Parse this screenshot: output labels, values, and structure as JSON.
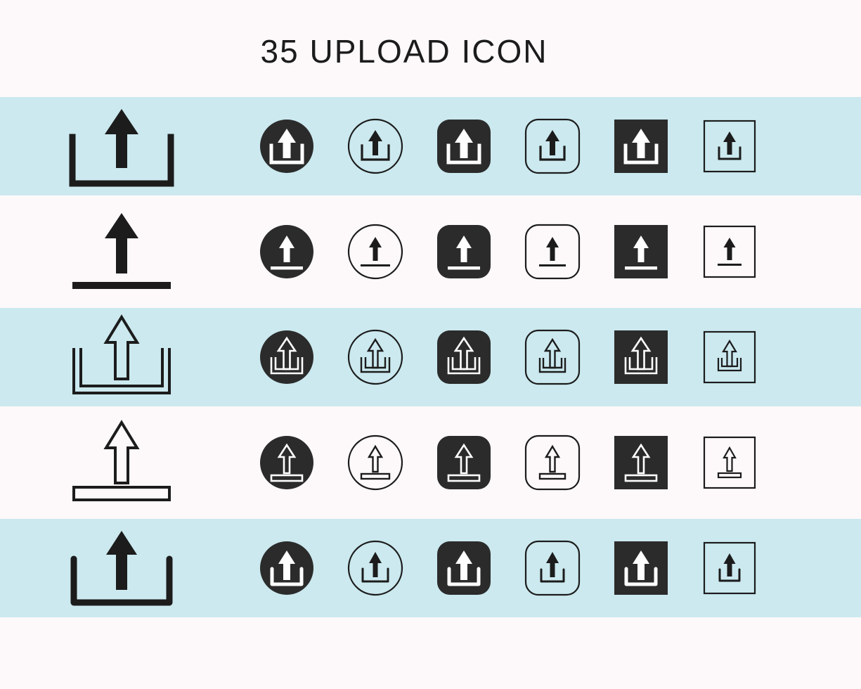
{
  "page": {
    "title": "35 UPLOAD ICON",
    "background_color": "#fdf9fa",
    "tinted_row_color": "#cbe9ef",
    "icon_dark_color": "#1c1c1c",
    "shape_fill_color": "#2b2b2b",
    "icon_light_color": "#ffffff"
  },
  "grid": {
    "row_count": 5,
    "columns_per_row": 7,
    "total_icons": 35,
    "column_styles": [
      {
        "name": "large-plain",
        "container": "none",
        "size": "large"
      },
      {
        "name": "filled-circle",
        "container": "circle",
        "fill": "solid"
      },
      {
        "name": "outline-circle",
        "container": "circle",
        "fill": "outline"
      },
      {
        "name": "filled-rounded-square",
        "container": "rounded-square",
        "fill": "solid"
      },
      {
        "name": "outline-rounded-square",
        "container": "rounded-square",
        "fill": "outline"
      },
      {
        "name": "filled-square",
        "container": "square",
        "fill": "solid"
      },
      {
        "name": "outline-square",
        "container": "square",
        "fill": "outline"
      }
    ],
    "rows": [
      {
        "index": 1,
        "tinted": true,
        "variant": "arrow-solid-over-open-tray",
        "label": "Solid arrow above open U-shaped tray"
      },
      {
        "index": 2,
        "tinted": false,
        "variant": "arrow-solid-over-line",
        "label": "Solid arrow above horizontal baseline"
      },
      {
        "index": 3,
        "tinted": true,
        "variant": "arrow-outline-over-open-tray",
        "label": "Outline arrow above open U-shaped tray"
      },
      {
        "index": 4,
        "tinted": false,
        "variant": "arrow-outline-over-bar",
        "label": "Outline arrow above outlined bar"
      },
      {
        "index": 5,
        "tinted": true,
        "variant": "arrow-solid-over-open-tray-thick",
        "label": "Solid arrow above open U-shaped tray, rounded corners"
      }
    ]
  }
}
